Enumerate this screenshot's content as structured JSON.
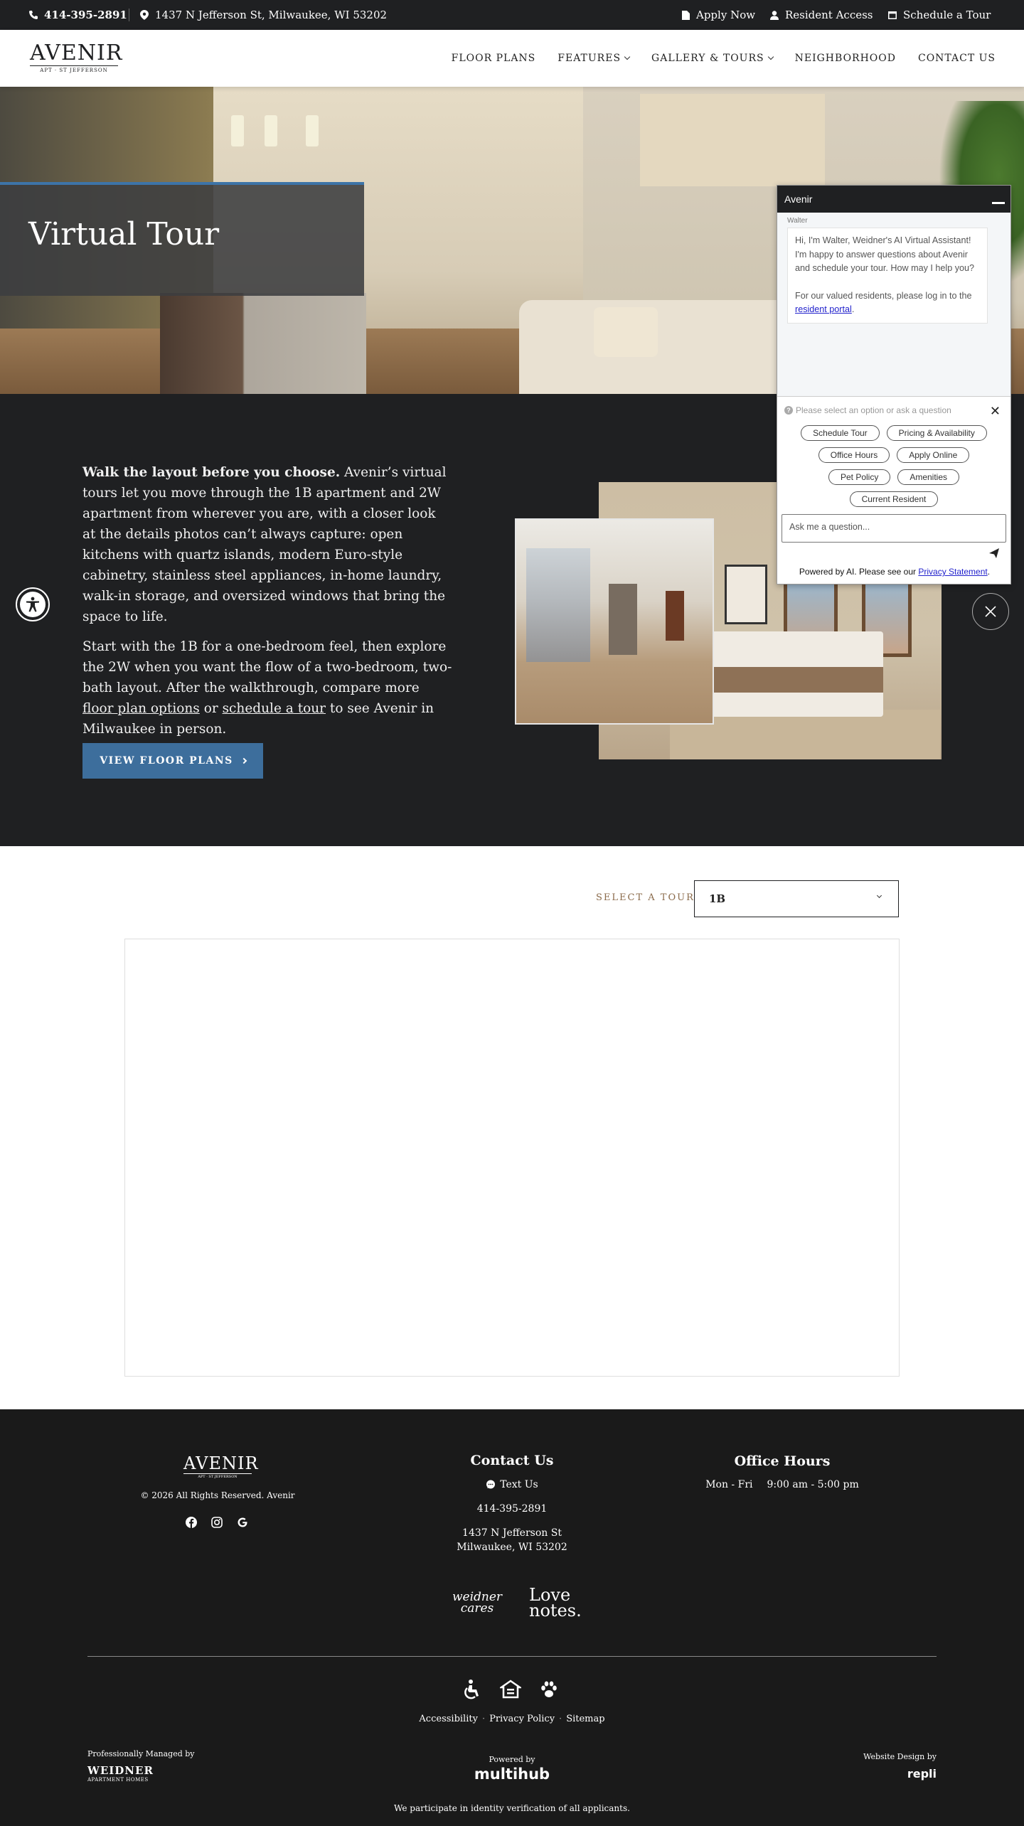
{
  "topbar": {
    "phone": "414-395-2891",
    "address": "1437 N Jefferson St, Milwaukee, WI 53202",
    "apply": "Apply Now",
    "resident": "Resident Access",
    "schedule": "Schedule a Tour"
  },
  "logo": {
    "word": "AVENIR",
    "sub": "APT · ST JEFFERSON"
  },
  "nav": {
    "items": [
      "FLOOR PLANS",
      "FEATURES",
      "GALLERY & TOURS",
      "NEIGHBORHOOD",
      "CONTACT US"
    ]
  },
  "hero": {
    "title": "Virtual Tour"
  },
  "intro": {
    "lead": "Walk the layout before you choose.",
    "p1": " Avenir’s virtual tours let you move through the 1B apartment and 2W apartment from wherever you are, with a closer look at the details photos can’t always capture: open kitchens with quartz islands, modern Euro-style cabinetry, stainless steel appliances, in-home laundry, walk-in storage, and oversized windows that bring the space to life.",
    "p2a": "Start with the 1B for a one-bedroom feel, then explore the 2W when you want the flow of a two-bedroom, two-bath layout. After the walkthrough, compare more ",
    "link1": "floor plan options",
    "p2b": " or ",
    "link2": "schedule a tour",
    "p2c": " to see Avenir in Milwaukee in person.",
    "button": "VIEW FLOOR PLANS"
  },
  "tour": {
    "label": "SELECT A TOUR",
    "selected": "1B"
  },
  "footer": {
    "logo_word": "AVENIR",
    "logo_sub": "APT · ST JEFFERSON",
    "copyright": "© 2026 All Rights Reserved. Avenir",
    "contact_title": "Contact Us",
    "text_us": "Text Us",
    "phone": "414-395-2891",
    "address1": "1437 N Jefferson St",
    "address2": "Milwaukee, WI 53202",
    "hours_title": "Office Hours",
    "hours_days": "Mon - Fri",
    "hours_time": "9:00 am - 5:00 pm",
    "brand1": "weidner cares",
    "brand2": "Love notes.",
    "links": [
      "Accessibility",
      "Privacy Policy",
      "Sitemap"
    ],
    "managed_by": "Professionally Managed by",
    "managed_mark": "WEIDNER",
    "managed_sub": "APARTMENT HOMES",
    "powered_by": "Powered by",
    "powered_mark": "multihub",
    "design_by": "Website Design by",
    "design_mark": "repli",
    "identity": "We participate in identity verification of all applicants."
  },
  "chat": {
    "title": "Avenir",
    "sender": "Walter",
    "greeting": "Hi, I'm Walter, Weidner's AI Virtual Assistant! I'm happy to answer questions about Avenir and schedule your tour. How may I help you?",
    "resident_note": "For our valued residents, please log in to the ",
    "resident_link": "resident portal",
    "hint": "Please select an option or ask a question",
    "options": [
      "Schedule Tour",
      "Pricing & Availability",
      "Office Hours",
      "Apply Online",
      "Pet Policy",
      "Amenities",
      "Current Resident"
    ],
    "input_placeholder": "Ask me a question...",
    "footer_text": "Powered by AI. Please see our ",
    "footer_link": "Privacy Statement"
  }
}
